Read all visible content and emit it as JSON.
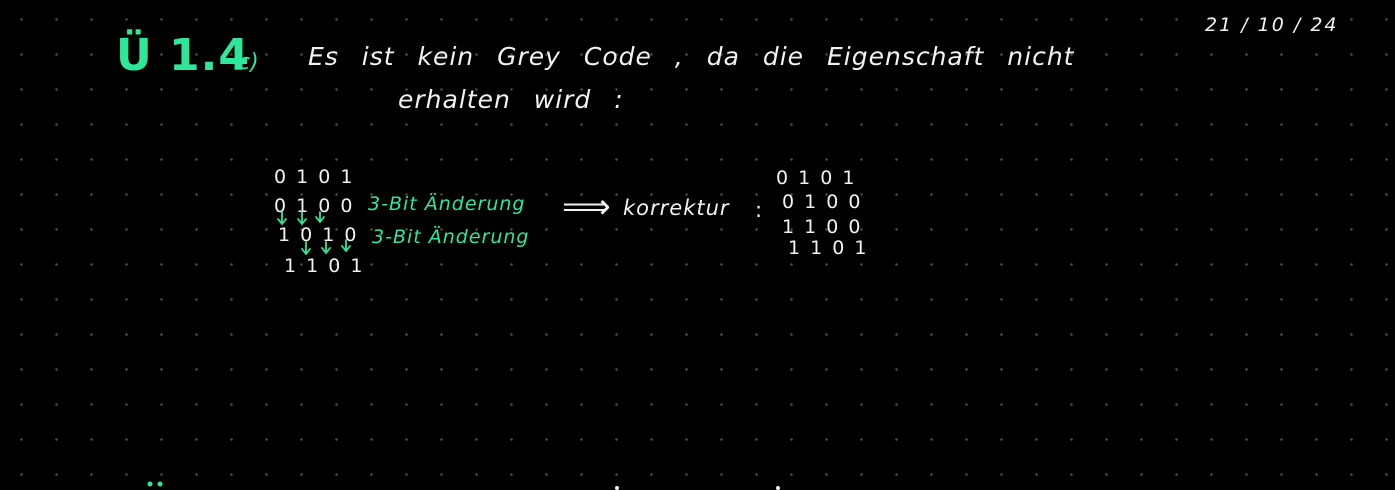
{
  "header": {
    "date": "21 / 10 / 24",
    "exercise_number": "Ü 1.4",
    "part_label": "c)"
  },
  "answer": {
    "line1": "Es ist kein Grey Code , da die Eigenschaft nicht",
    "line2": "erhalten wird :"
  },
  "original_sequence": {
    "rows": [
      "0 1 0 1",
      "0 1 0 0",
      "1 0 1 0",
      "1 1 0 1"
    ],
    "notes": [
      "3-Bit Änderung",
      "3-Bit Änderung"
    ]
  },
  "correction": {
    "label": "korrektur",
    "colon": ":",
    "rows": [
      "0 1 0 1",
      "0 1 0 0",
      "1 1 0 0",
      "1 1 0 1"
    ]
  },
  "colors": {
    "accent": "#2ee89a",
    "ink": "#f2f2f2",
    "background": "#000000"
  }
}
